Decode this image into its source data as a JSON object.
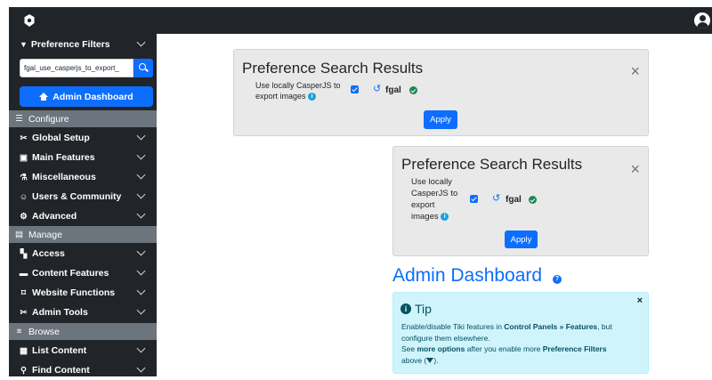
{
  "sidebar": {
    "filters_label": "Preference Filters",
    "search_value": "fgal_use_casperjs_to_export_",
    "admin_dashboard_label": "Admin Dashboard",
    "sections": {
      "configure": "Configure",
      "manage": "Manage",
      "browse": "Browse"
    },
    "configure_items": [
      "Global Setup",
      "Main Features",
      "Miscellaneous",
      "Users & Community",
      "Advanced"
    ],
    "manage_items": [
      "Access",
      "Content Features",
      "Website Functions",
      "Admin Tools"
    ],
    "browse_items": [
      "List Content",
      "Find Content"
    ]
  },
  "results1": {
    "title": "Preference Search Results",
    "pref_line1": "Use locally CasperJS to",
    "pref_line2": "export images",
    "pref_tag": "fgal",
    "apply_label": "Apply"
  },
  "results2": {
    "title": "Preference Search Results",
    "pref_line1": "Use locally",
    "pref_line2": "CasperJS to",
    "pref_line3": "export",
    "pref_line4": "images",
    "pref_tag": "fgal",
    "apply_label": "Apply"
  },
  "dashboard": {
    "title": "Admin Dashboard"
  },
  "tip": {
    "title": "Tip",
    "line1_pre": "Enable/disable Tiki features in ",
    "line1_bold": "Control Panels » Features",
    "line1_post": ", but",
    "line2": "configure them elsewhere.",
    "line3_pre": "See ",
    "line3_bold1": "more options",
    "line3_mid": " after you enable more ",
    "line3_bold2": "Preference Filters",
    "line4_pre": "above (",
    "line4_post": ")."
  },
  "colors": {
    "primary": "#0d6efd",
    "sidebar_bg": "#212529",
    "section_bg": "#6c757d",
    "tip_bg": "#cff4fc",
    "success": "#198754",
    "info": "#17a2d8"
  },
  "icons": [
    "tiki-logo-icon",
    "user-avatar-icon",
    "filter-icon",
    "search-icon",
    "home-icon",
    "close-icon",
    "info-icon",
    "reset-icon",
    "check-icon",
    "question-icon"
  ]
}
